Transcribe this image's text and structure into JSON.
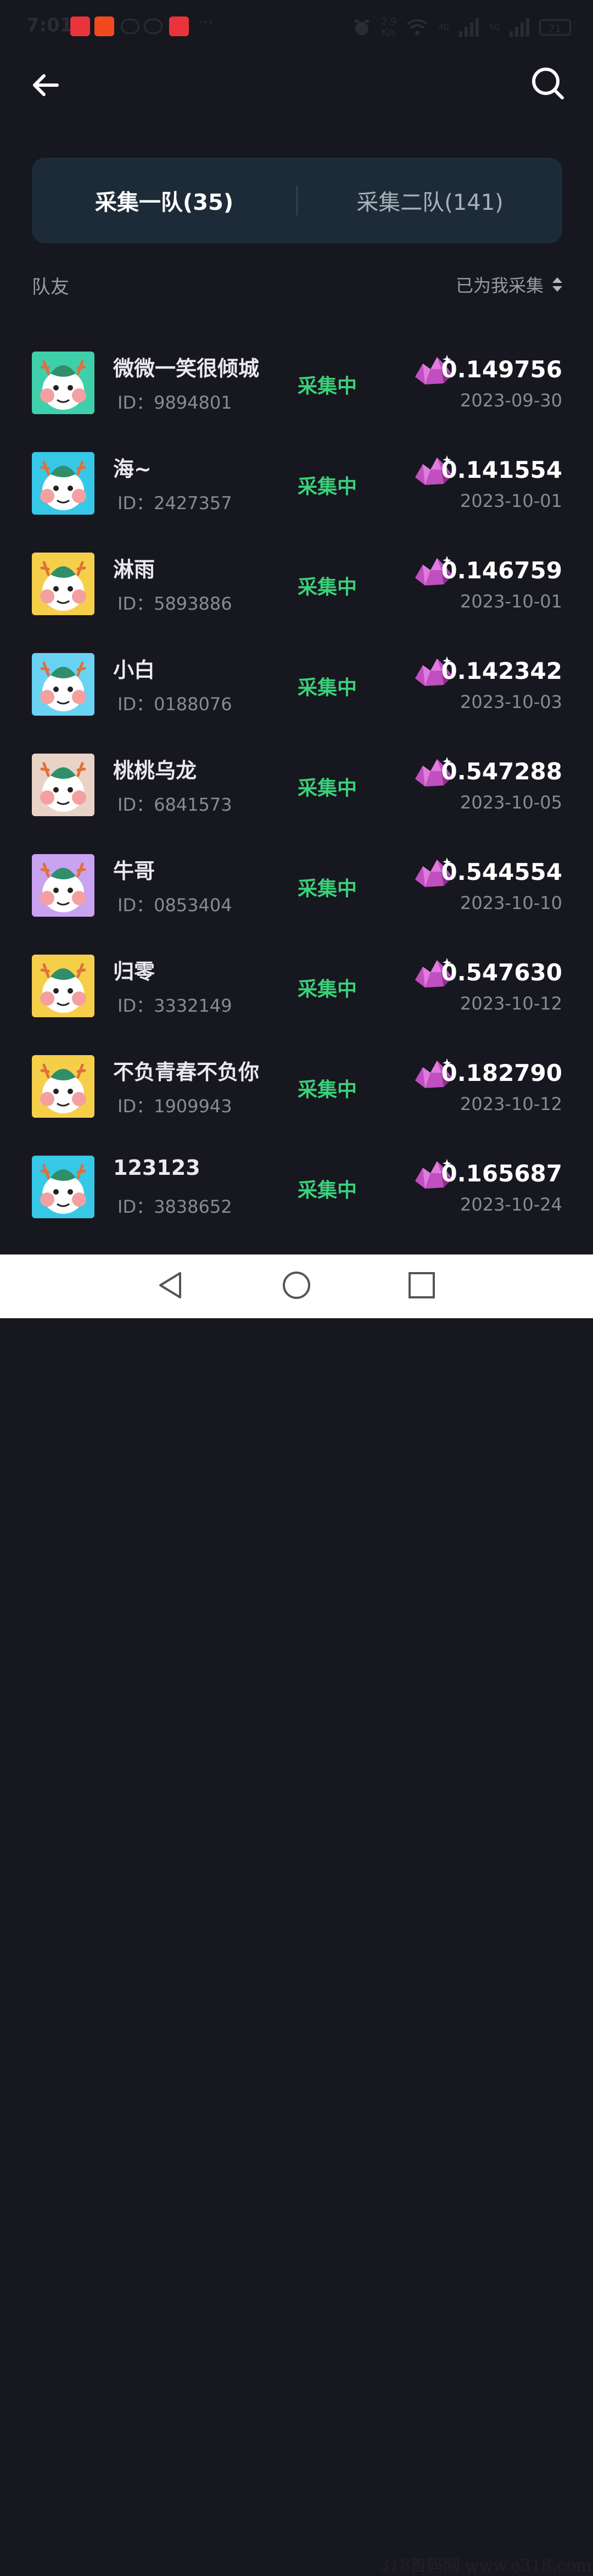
{
  "status_bar": {
    "time": "7:01",
    "overflow": "···",
    "net_speed": "2.9",
    "net_speed_unit": "K/s",
    "signal1": "4G",
    "signal2": "5G",
    "battery": "71"
  },
  "tabs": [
    {
      "label": "采集一队(35)",
      "active": true
    },
    {
      "label": "采集二队(141)",
      "active": false
    }
  ],
  "list_header": {
    "title": "队友",
    "sort_label": "已为我采集"
  },
  "members": [
    {
      "name": "微微一笑很倾城",
      "id": "ID：9894801",
      "status": "采集中",
      "amount": "0.149756",
      "date": "2023-09-30",
      "avatar_color": "#3fcfaa"
    },
    {
      "name": "海~",
      "id": "ID：2427357",
      "status": "采集中",
      "amount": "0.141554",
      "date": "2023-10-01",
      "avatar_color": "#36c8e6"
    },
    {
      "name": "淋雨",
      "id": "ID：5893886",
      "status": "采集中",
      "amount": "0.146759",
      "date": "2023-10-01",
      "avatar_color": "#f6cf4a"
    },
    {
      "name": "小白",
      "id": "ID：0188076",
      "status": "采集中",
      "amount": "0.142342",
      "date": "2023-10-03",
      "avatar_color": "#6ad3f4"
    },
    {
      "name": "桃桃乌龙",
      "id": "ID：6841573",
      "status": "采集中",
      "amount": "0.547288",
      "date": "2023-10-05",
      "avatar_color": "#e8d3c6"
    },
    {
      "name": "牛哥",
      "id": "ID：0853404",
      "status": "采集中",
      "amount": "0.544554",
      "date": "2023-10-10",
      "avatar_color": "#c9a2f0"
    },
    {
      "name": "归零",
      "id": "ID：3332149",
      "status": "采集中",
      "amount": "0.547630",
      "date": "2023-10-12",
      "avatar_color": "#f6cf4a"
    },
    {
      "name": "不负青春不负你",
      "id": "ID：1909943",
      "status": "采集中",
      "amount": "0.182790",
      "date": "2023-10-12",
      "avatar_color": "#f6cf4a"
    },
    {
      "name": "123123",
      "id": "ID：3838652",
      "status": "采集中",
      "amount": "0.165687",
      "date": "2023-10-24",
      "avatar_color": "#36c8e6"
    }
  ],
  "watermark": "318首码网  www.e318.com",
  "colors": {
    "background": "#17171f",
    "tab_bar": "#1d2b38",
    "status_green": "#3ad17a",
    "gem": "#c04fc0"
  }
}
